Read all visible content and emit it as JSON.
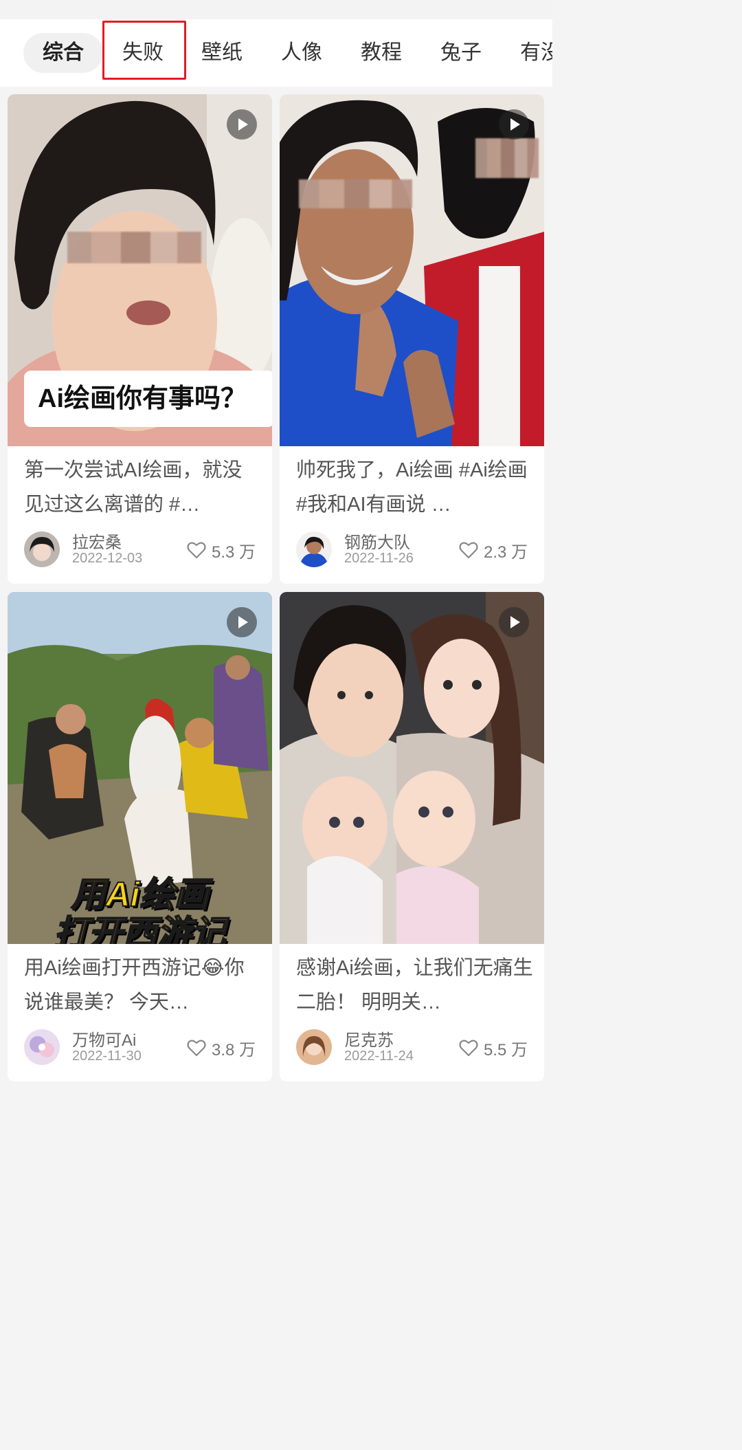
{
  "tabs": [
    {
      "label": "综合",
      "active": true
    },
    {
      "label": "失败",
      "active": false
    },
    {
      "label": "壁纸",
      "active": false
    },
    {
      "label": "人像",
      "active": false
    },
    {
      "label": "教程",
      "active": false
    },
    {
      "label": "兔子",
      "active": false
    },
    {
      "label": "有没",
      "active": false
    }
  ],
  "colors": {
    "highlight_box": "#e31b23",
    "like_icon": "#888888"
  },
  "cards": [
    {
      "overlay_text": "Ai绘画你有事吗？",
      "title": "第一次尝试AI绘画，就没见过这么离谱的 #…",
      "author": "拉宏桑",
      "date": "2022-12-03",
      "likes": "5.3 万",
      "icon": "play-icon"
    },
    {
      "title": "帅死我了，Ai绘画 #Ai绘画 #我和AI有画说 …",
      "author": "钢筋大队",
      "date": "2022-11-26",
      "likes": "2.3 万",
      "icon": "play-icon"
    },
    {
      "overlay_line1": "用Ai绘画",
      "overlay_line2": "打开西游记",
      "title": "用Ai绘画打开西游记😂你说谁最美？ 今天…",
      "author": "万物可Ai",
      "date": "2022-11-30",
      "likes": "3.8 万",
      "icon": "play-icon"
    },
    {
      "title": "感谢Ai绘画，让我们无痛生二胎！ 明明关…",
      "author": "尼克苏",
      "date": "2022-11-24",
      "likes": "5.5 万",
      "icon": "play-icon"
    }
  ]
}
